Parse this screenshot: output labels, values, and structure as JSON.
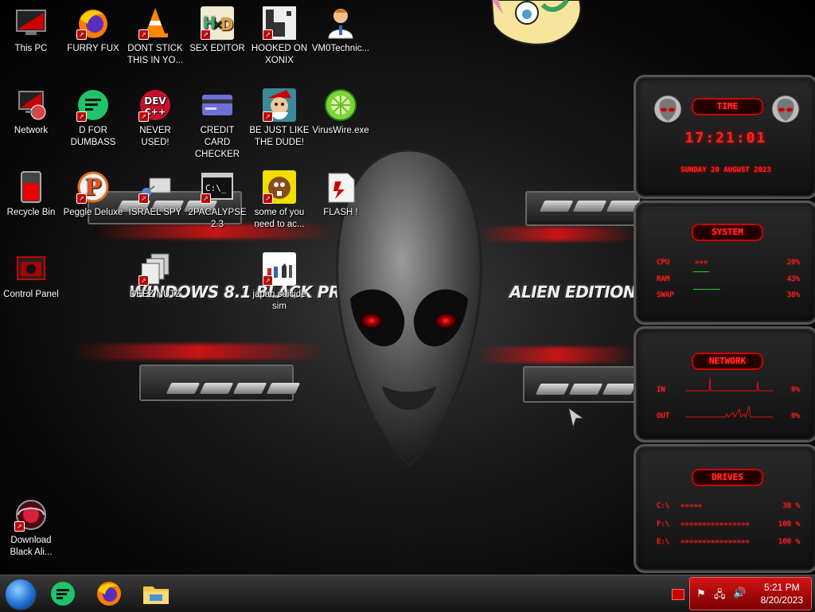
{
  "desktop": {
    "icons": [
      {
        "label": "This PC",
        "icon": "this-pc-icon"
      },
      {
        "label": "FURRY FUX",
        "icon": "firefox-icon"
      },
      {
        "label": "DONT STICK THIS IN YO...",
        "icon": "vlc-cone-icon"
      },
      {
        "label": "SEX EDITOR",
        "icon": "hxd-editor-icon"
      },
      {
        "label": "HOOKED ON XONIX",
        "icon": "xonix-game-icon"
      },
      {
        "label": "VM0Technic...",
        "icon": "doctor-avatar-icon"
      },
      {
        "label": "Network",
        "icon": "network-icon"
      },
      {
        "label": "D FOR DUMBASS",
        "icon": "discord-green-icon"
      },
      {
        "label": "NEVER USED!",
        "icon": "dev-cpp-icon"
      },
      {
        "label": "CREDIT CARD CHECKER",
        "icon": "credit-card-icon"
      },
      {
        "label": "BE JUST LIKE THE DUDE!",
        "icon": "elf-icon"
      },
      {
        "label": "VirusWire.exe",
        "icon": "limewire-icon"
      },
      {
        "label": "Recycle Bin",
        "icon": "recycle-bin-icon"
      },
      {
        "label": "Peggle Deluxe",
        "icon": "peggle-icon"
      },
      {
        "label": "ISRAEL SPY",
        "icon": "spy-network-icon"
      },
      {
        "label": "2PACALYPSE 2.3",
        "icon": "console-icon"
      },
      {
        "label": "some of you need to ac...",
        "icon": "beaver-icon"
      },
      {
        "label": "FLASH !",
        "icon": "flash-icon"
      },
      {
        "label": "Control Panel",
        "icon": "control-panel-icon"
      },
      {
        "label": "DEEZ NUTZ",
        "icon": "stacked-windows-icon"
      },
      {
        "label": "japan suicide sim",
        "icon": "chess-document-icon"
      },
      {
        "label": "Download Black Ali...",
        "icon": "alien-download-icon"
      }
    ]
  },
  "wallpaper": {
    "left_text": "WINDOWS 8.1 BLACK PRO",
    "right_text": "ALIEN EDITION 20"
  },
  "gadgets": {
    "time": {
      "title": "TIME",
      "time": "17:21:01",
      "date": "SUNDAY 20 AUGUST 2023"
    },
    "system": {
      "title": "SYSTEM",
      "rows": [
        {
          "label": "CPU",
          "value": "20%"
        },
        {
          "label": "RAM",
          "value": "43%"
        },
        {
          "label": "SWAP",
          "value": "38%"
        }
      ]
    },
    "network": {
      "title": "NETWORK",
      "rows": [
        {
          "label": "IN",
          "value": "0%"
        },
        {
          "label": "OUT",
          "value": "0%"
        }
      ]
    },
    "drives": {
      "title": "DRIVES",
      "rows": [
        {
          "label": "C:\\",
          "value": "38 %"
        },
        {
          "label": "F:\\",
          "value": "100 %"
        },
        {
          "label": "E:\\",
          "value": "100 %"
        }
      ]
    }
  },
  "taskbar": {
    "start": "start-orb-icon",
    "pinned": [
      "discord-green-icon",
      "firefox-icon",
      "file-explorer-icon"
    ],
    "clock": {
      "time": "5:21 PM",
      "date": "8/20/2023"
    },
    "tray": [
      "flag-icon",
      "network-icon",
      "speaker-icon"
    ]
  },
  "colors": {
    "accent": "#e01010",
    "tray": "#b00000"
  }
}
